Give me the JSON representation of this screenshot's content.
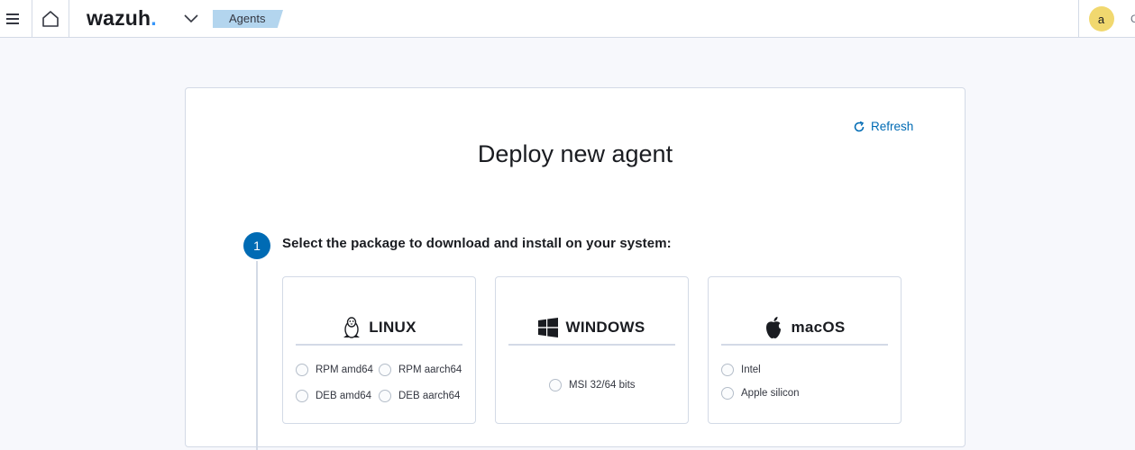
{
  "header": {
    "logo_text": "wazuh",
    "logo_dot": ".",
    "breadcrumb": "Agents",
    "user_initial": "a",
    "edge_glyph": "C"
  },
  "panel": {
    "refresh_label": "Refresh",
    "title": "Deploy new agent",
    "step": {
      "number": "1",
      "title": "Select the package to download and install on your system:"
    },
    "os_cards": [
      {
        "name": "LINUX",
        "icon": "linux-penguin-icon",
        "options": [
          "RPM amd64",
          "RPM aarch64",
          "DEB amd64",
          "DEB aarch64"
        ]
      },
      {
        "name": "WINDOWS",
        "icon": "windows-logo-icon",
        "options": [
          "MSI 32/64 bits"
        ]
      },
      {
        "name": "macOS",
        "icon": "apple-logo-icon",
        "options": [
          "Intel",
          "Apple silicon"
        ]
      }
    ]
  },
  "colors": {
    "accent": "#006bb4",
    "logo_dot": "#3595f9",
    "breadcrumb_bg": "#b3d5ee",
    "avatar_bg": "#f1d86f",
    "border": "#d3dae6",
    "page_bg": "#f7f8fc"
  }
}
